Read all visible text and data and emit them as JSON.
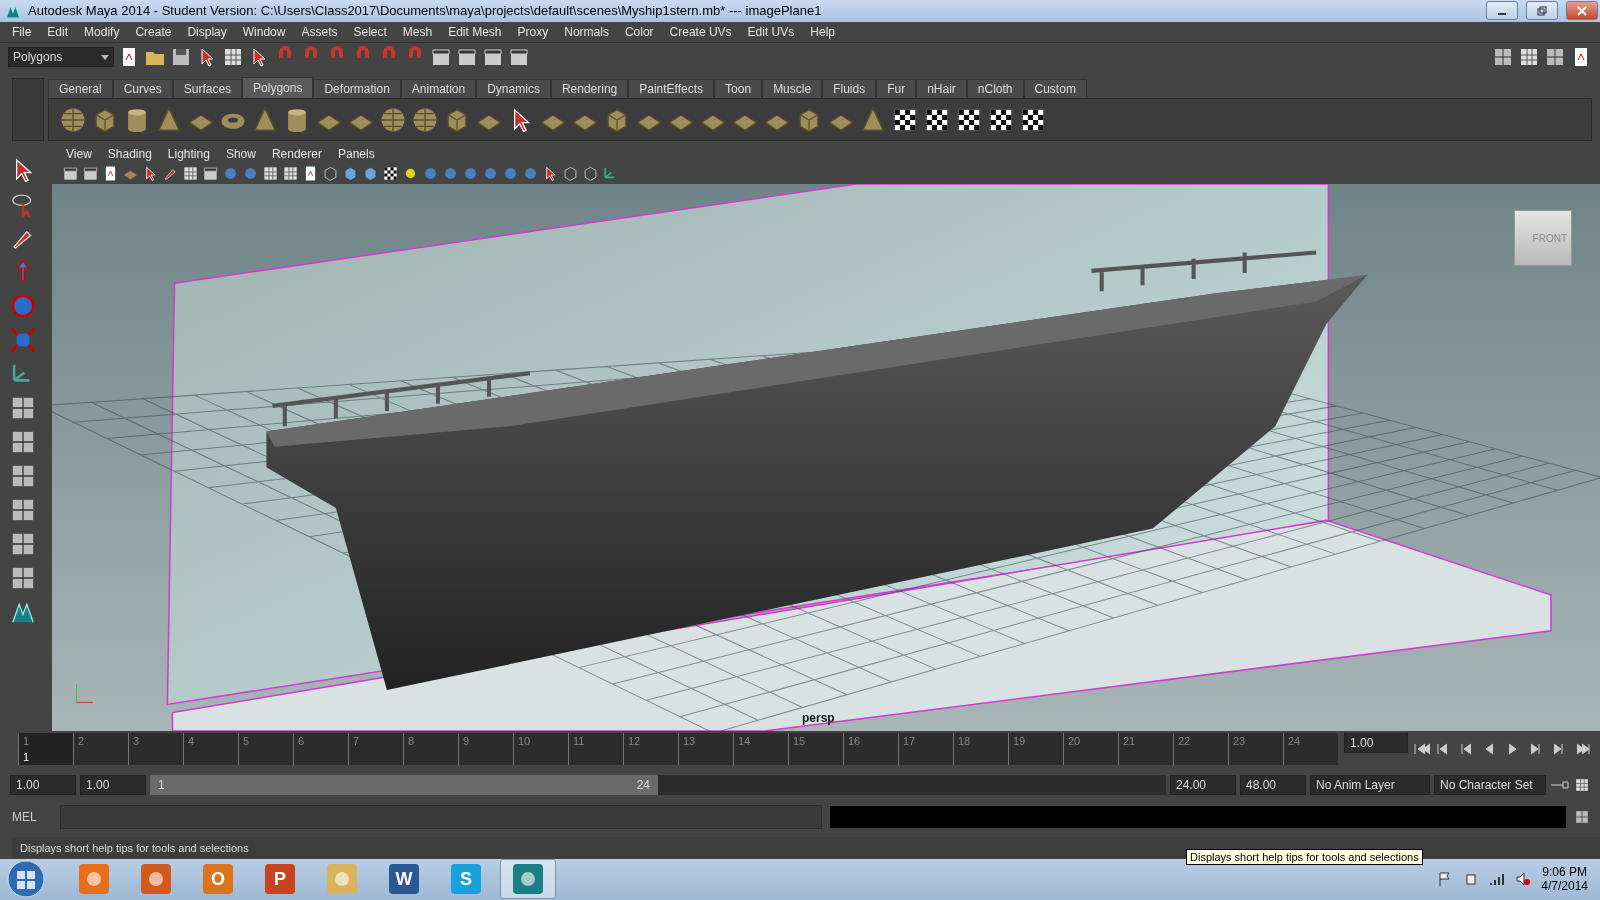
{
  "window": {
    "title": "Autodesk Maya 2014 - Student Version: C:\\Users\\Class2017\\Documents\\maya\\projects\\default\\scenes\\Myship1stern.mb*  ---  imagePlane1"
  },
  "menu_bar": [
    "File",
    "Edit",
    "Modify",
    "Create",
    "Display",
    "Window",
    "Assets",
    "Select",
    "Mesh",
    "Edit Mesh",
    "Proxy",
    "Normals",
    "Color",
    "Create UVs",
    "Edit UVs",
    "Help"
  ],
  "status_line": {
    "menu_set": "Polygons"
  },
  "shelf": {
    "tabs": [
      {
        "label": "General",
        "selected": false
      },
      {
        "label": "Curves",
        "selected": false
      },
      {
        "label": "Surfaces",
        "selected": false
      },
      {
        "label": "Polygons",
        "selected": true
      },
      {
        "label": "Deformation",
        "selected": false
      },
      {
        "label": "Animation",
        "selected": false
      },
      {
        "label": "Dynamics",
        "selected": false
      },
      {
        "label": "Rendering",
        "selected": false
      },
      {
        "label": "PaintEffects",
        "selected": false
      },
      {
        "label": "Toon",
        "selected": false
      },
      {
        "label": "Muscle",
        "selected": false
      },
      {
        "label": "Fluids",
        "selected": false
      },
      {
        "label": "Fur",
        "selected": false
      },
      {
        "label": "nHair",
        "selected": false
      },
      {
        "label": "nCloth",
        "selected": false
      },
      {
        "label": "Custom",
        "selected": false
      }
    ]
  },
  "panel": {
    "menu": [
      "View",
      "Shading",
      "Lighting",
      "Show",
      "Renderer",
      "Panels"
    ],
    "camera": "persp",
    "view_cube": "FRONT"
  },
  "time_slider": {
    "ticks": [
      "1",
      "2",
      "3",
      "4",
      "5",
      "6",
      "7",
      "8",
      "9",
      "10",
      "11",
      "12",
      "13",
      "14",
      "15",
      "16",
      "17",
      "18",
      "19",
      "20",
      "21",
      "22",
      "23",
      "24"
    ],
    "current_frame": "1",
    "current_time": "1.00"
  },
  "range_slider": {
    "start_time": "1.00",
    "playback_start": "1.00",
    "range_start": "1",
    "range_end": "24",
    "level": 0.5,
    "playback_end": "24.00",
    "end_time": "48.00",
    "anim_layer": "No Anim Layer",
    "character_set": "No Character Set"
  },
  "command_line": {
    "language": "MEL"
  },
  "help_line": "Displays short help tips for tools and selections",
  "tooltip": "Displays short help tips for tools and selections",
  "taskbar": {
    "apps": [
      {
        "kind": "media",
        "selected": false
      },
      {
        "kind": "browser",
        "selected": false
      },
      {
        "kind": "mail",
        "glyph": "O",
        "selected": false
      },
      {
        "kind": "slides",
        "glyph": "P",
        "selected": false
      },
      {
        "kind": "folder",
        "selected": false
      },
      {
        "kind": "document",
        "glyph": "W",
        "selected": false
      },
      {
        "kind": "chat",
        "glyph": "S",
        "selected": false
      },
      {
        "kind": "maya",
        "selected": true
      }
    ],
    "time": "9:06 PM",
    "date": "4/7/2014"
  }
}
